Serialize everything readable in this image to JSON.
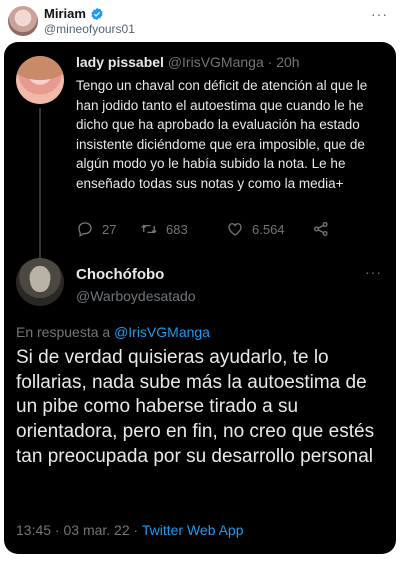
{
  "outer": {
    "name": "Miriam",
    "handle": "@mineofyours01",
    "more_icon": "more-horizontal-icon",
    "verified_color": "#1d9bf0"
  },
  "replied_tweet": {
    "name": "lady pissabel",
    "handle": "@IrisVGManga",
    "separator": " · ",
    "time": "20h",
    "text": "Tengo un chaval con déficit de atención al que le han jodido tanto el autoestima que cuando le he dicho que ha aprobado la evaluación ha estado insistente diciéndome que era imposible, que de algún modo yo le había subido la nota. Le he enseñado todas sus notas y como la media+",
    "actions": {
      "replies": "27",
      "retweets": "683",
      "likes": "6.564"
    }
  },
  "main_tweet": {
    "name": "Chochófobo",
    "handle": "@Warboydesatado",
    "reply_prefix": "En respuesta a ",
    "reply_to": "@IrisVGManga",
    "text": "Si de verdad quisieras ayudarlo, te lo follarias, nada sube más la autoestima de un pibe como haberse tirado a su orientadora, pero en fin, no creo que estés tan preocupada por su desarrollo personal",
    "timestamp": "13:45 · 03 mar. 22 · ",
    "source": "Twitter Web App"
  },
  "colors": {
    "link": "#1d9bf0",
    "card_bg": "#000000",
    "text_light": "#e7e9ea",
    "muted": "#71767b"
  }
}
